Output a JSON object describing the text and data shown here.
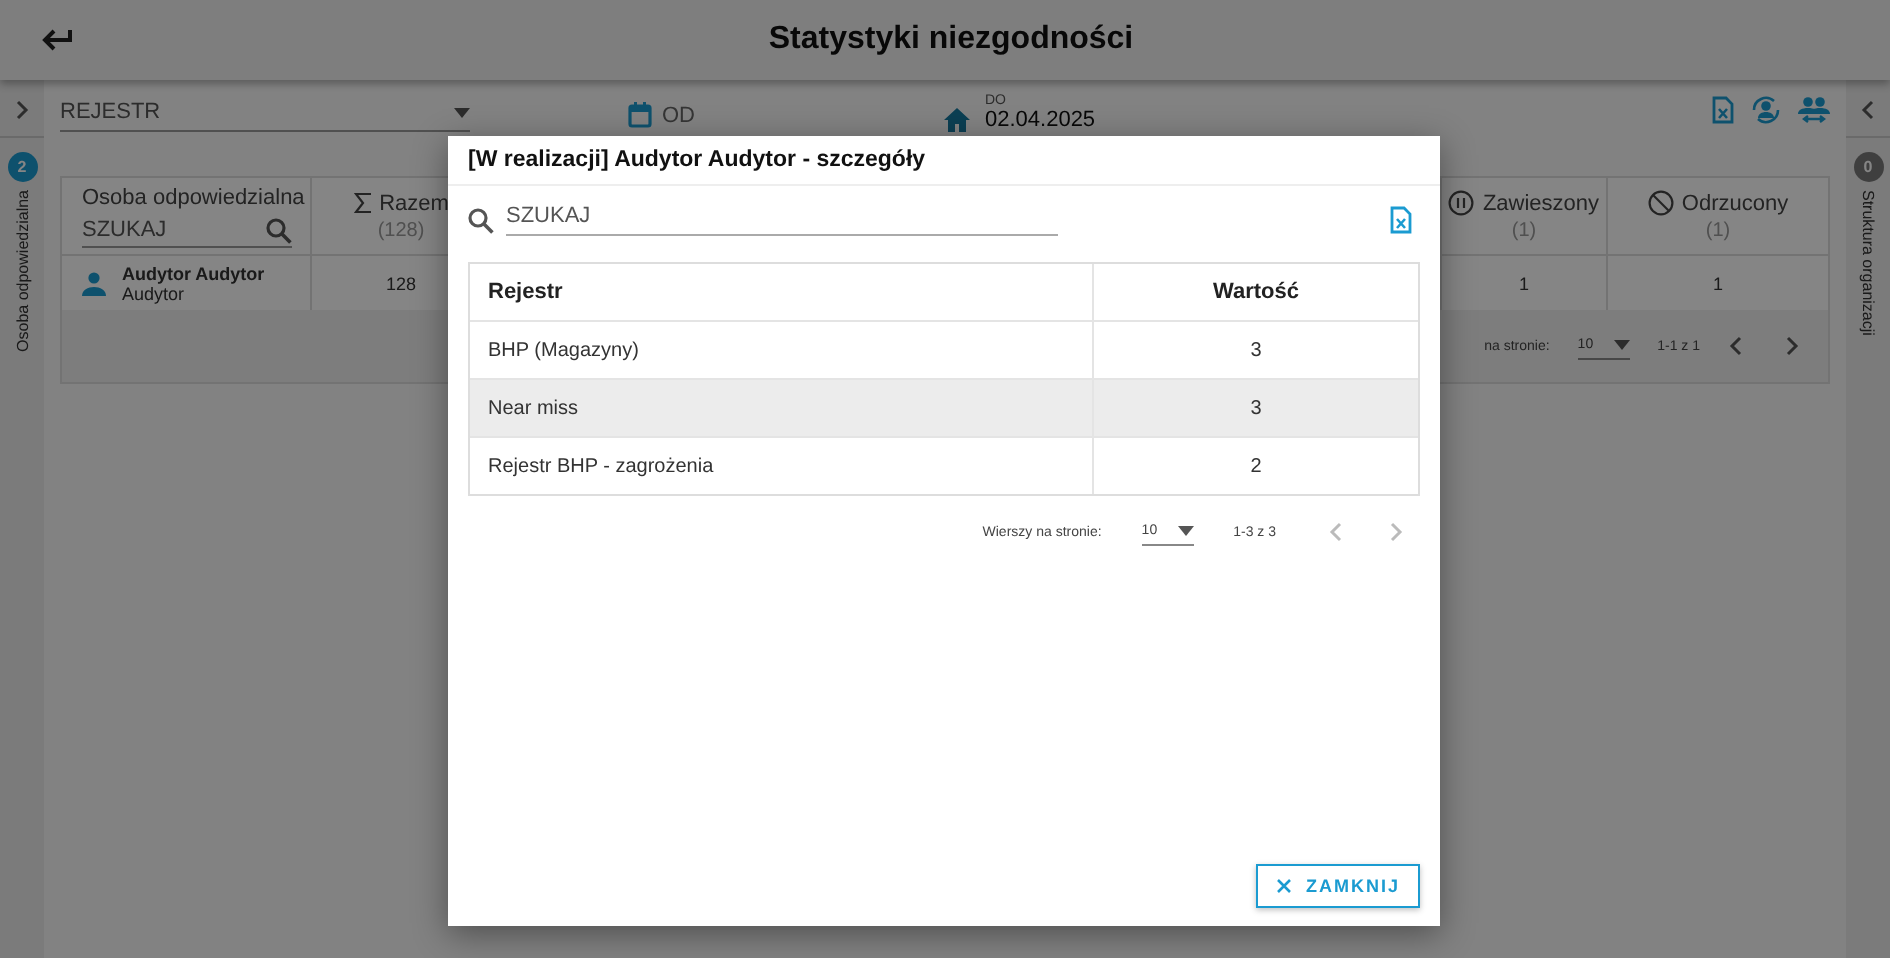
{
  "header": {
    "title": "Statystyki niezgodności"
  },
  "left_panel": {
    "badge": "2",
    "label": "Osoba odpowiedzialna"
  },
  "right_panel": {
    "badge": "0",
    "label": "Struktura organizacji"
  },
  "filters": {
    "register": {
      "placeholder": "REJESTR"
    },
    "from": {
      "placeholder": "OD"
    },
    "to": {
      "label": "DO",
      "value": "02.04.2025"
    }
  },
  "table": {
    "columns": [
      {
        "kind": "person",
        "title": "Osoba odpowiedzialna",
        "search_placeholder": "SZUKAJ"
      },
      {
        "kind": "total",
        "title": "Razem",
        "count": "(128)"
      },
      {
        "kind": "suspended",
        "title": "Zawieszony",
        "count": "(1)"
      },
      {
        "kind": "rejected",
        "title": "Odrzucony",
        "count": "(1)"
      }
    ],
    "rows": [
      {
        "name": "Audytor Audytor",
        "role": "Audytor",
        "values": [
          "128",
          "1",
          "1"
        ]
      }
    ]
  },
  "pagination": {
    "rows_label": "na stronie:",
    "page_size": "10",
    "range": "1-1 z 1"
  },
  "dialog": {
    "title": "[W realizacji] Audytor Audytor - szczegóły",
    "search": {
      "placeholder": "SZUKAJ"
    },
    "columns": [
      "Rejestr",
      "Wartość"
    ],
    "rows": [
      {
        "register": "BHP (Magazyny)",
        "value": "3",
        "highlighted": false
      },
      {
        "register": "Near miss",
        "value": "3",
        "highlighted": true
      },
      {
        "register": "Rejestr BHP - zagrożenia",
        "value": "2",
        "highlighted": false
      }
    ],
    "pagination": {
      "rows_label": "Wierszy na stronie:",
      "page_size": "10",
      "range": "1-3 z 3"
    },
    "close_button": "ZAMKNIJ"
  }
}
